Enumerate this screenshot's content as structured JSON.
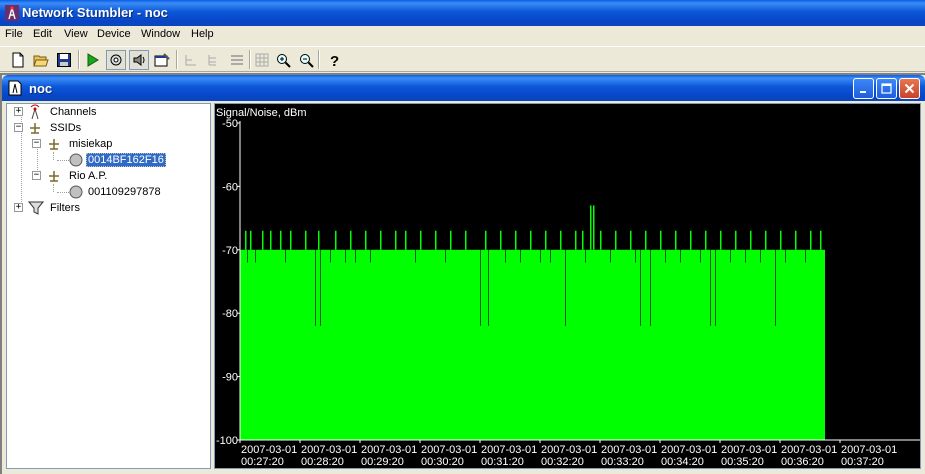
{
  "app": {
    "title": "Network Stumbler - noc",
    "menu": [
      "File",
      "Edit",
      "View",
      "Device",
      "Window",
      "Help"
    ]
  },
  "toolbar": {
    "buttons": [
      "new-document-icon",
      "open-folder-icon",
      "save-icon",
      "play-icon",
      "auto-config-icon",
      "speaker-icon",
      "properties-icon",
      "tree-collapse-icon",
      "tree-expand-icon",
      "list-view-icon",
      "grid-icon",
      "zoom-in-icon",
      "zoom-out-icon",
      "help-icon"
    ]
  },
  "child": {
    "title": "noc",
    "tree": {
      "channels": "Channels",
      "ssids": "SSIDs",
      "ssid1": "misiekap",
      "ap1": "0014BF162F16",
      "ssid2": "Rio A.P.",
      "ap2": "001109297878",
      "filters": "Filters"
    }
  },
  "colors": {
    "signal": "#00ff00",
    "background": "#000000",
    "text": "#ffffff",
    "selection": "#316ac5"
  },
  "chart_data": {
    "type": "area",
    "ylabel": "Signal/Noise, dBm",
    "ylim": [
      -100,
      -50
    ],
    "yticks": [
      "-50",
      "-60",
      "-70",
      "-80",
      "-90",
      "-100"
    ],
    "xticks": [
      {
        "date": "2007-03-01",
        "time": "00:27:20"
      },
      {
        "date": "2007-03-01",
        "time": "00:28:20"
      },
      {
        "date": "2007-03-01",
        "time": "00:29:20"
      },
      {
        "date": "2007-03-01",
        "time": "00:30:20"
      },
      {
        "date": "2007-03-01",
        "time": "00:31:20"
      },
      {
        "date": "2007-03-01",
        "time": "00:32:20"
      },
      {
        "date": "2007-03-01",
        "time": "00:33:20"
      },
      {
        "date": "2007-03-01",
        "time": "00:34:20"
      },
      {
        "date": "2007-03-01",
        "time": "00:35:20"
      },
      {
        "date": "2007-03-01",
        "time": "00:36:20"
      },
      {
        "date": "2007-03-01",
        "time": "00:37:20"
      }
    ],
    "series": [
      {
        "baseline": -70,
        "samples_start": "00:27:20",
        "samples_end": "00:37:05",
        "spikes_up": [
          {
            "t": "00:27:25",
            "v": -67
          },
          {
            "t": "00:27:30",
            "v": -67
          },
          {
            "t": "00:27:42",
            "v": -67
          },
          {
            "t": "00:27:50",
            "v": -67
          },
          {
            "t": "00:28:00",
            "v": -67
          },
          {
            "t": "00:28:10",
            "v": -67
          },
          {
            "t": "00:28:25",
            "v": -67
          },
          {
            "t": "00:28:38",
            "v": -67
          },
          {
            "t": "00:28:55",
            "v": -67
          },
          {
            "t": "00:29:10",
            "v": -67
          },
          {
            "t": "00:29:25",
            "v": -67
          },
          {
            "t": "00:29:40",
            "v": -67
          },
          {
            "t": "00:29:55",
            "v": -67
          },
          {
            "t": "00:30:05",
            "v": -67
          },
          {
            "t": "00:30:20",
            "v": -67
          },
          {
            "t": "00:30:35",
            "v": -67
          },
          {
            "t": "00:30:50",
            "v": -67
          },
          {
            "t": "00:31:05",
            "v": -67
          },
          {
            "t": "00:31:25",
            "v": -67
          },
          {
            "t": "00:31:40",
            "v": -67
          },
          {
            "t": "00:31:55",
            "v": -67
          },
          {
            "t": "00:32:10",
            "v": -67
          },
          {
            "t": "00:32:25",
            "v": -67
          },
          {
            "t": "00:32:40",
            "v": -67
          },
          {
            "t": "00:32:55",
            "v": -67
          },
          {
            "t": "00:33:02",
            "v": -67
          },
          {
            "t": "00:33:10",
            "v": -63
          },
          {
            "t": "00:33:13",
            "v": -63
          },
          {
            "t": "00:33:20",
            "v": -67
          },
          {
            "t": "00:33:35",
            "v": -67
          },
          {
            "t": "00:33:50",
            "v": -67
          },
          {
            "t": "00:34:05",
            "v": -67
          },
          {
            "t": "00:34:20",
            "v": -67
          },
          {
            "t": "00:34:35",
            "v": -67
          },
          {
            "t": "00:34:50",
            "v": -67
          },
          {
            "t": "00:35:05",
            "v": -67
          },
          {
            "t": "00:35:20",
            "v": -67
          },
          {
            "t": "00:35:35",
            "v": -67
          },
          {
            "t": "00:35:50",
            "v": -67
          },
          {
            "t": "00:36:05",
            "v": -67
          },
          {
            "t": "00:36:20",
            "v": -67
          },
          {
            "t": "00:36:35",
            "v": -67
          },
          {
            "t": "00:36:50",
            "v": -67
          },
          {
            "t": "00:37:00",
            "v": -67
          }
        ],
        "spikes_down": [
          {
            "t": "00:27:27",
            "v": -72
          },
          {
            "t": "00:27:35",
            "v": -72
          },
          {
            "t": "00:28:05",
            "v": -72
          },
          {
            "t": "00:28:35",
            "v": -82
          },
          {
            "t": "00:28:40",
            "v": -82
          },
          {
            "t": "00:28:50",
            "v": -72
          },
          {
            "t": "00:29:05",
            "v": -72
          },
          {
            "t": "00:29:15",
            "v": -72
          },
          {
            "t": "00:29:30",
            "v": -72
          },
          {
            "t": "00:30:15",
            "v": -72
          },
          {
            "t": "00:30:45",
            "v": -72
          },
          {
            "t": "00:31:20",
            "v": -82
          },
          {
            "t": "00:31:28",
            "v": -82
          },
          {
            "t": "00:31:45",
            "v": -72
          },
          {
            "t": "00:32:00",
            "v": -72
          },
          {
            "t": "00:32:20",
            "v": -72
          },
          {
            "t": "00:32:30",
            "v": -72
          },
          {
            "t": "00:32:45",
            "v": -82
          },
          {
            "t": "00:33:05",
            "v": -72
          },
          {
            "t": "00:33:30",
            "v": -72
          },
          {
            "t": "00:33:55",
            "v": -72
          },
          {
            "t": "00:34:00",
            "v": -82
          },
          {
            "t": "00:34:10",
            "v": -82
          },
          {
            "t": "00:34:25",
            "v": -72
          },
          {
            "t": "00:34:40",
            "v": -72
          },
          {
            "t": "00:35:00",
            "v": -72
          },
          {
            "t": "00:35:10",
            "v": -82
          },
          {
            "t": "00:35:15",
            "v": -82
          },
          {
            "t": "00:35:30",
            "v": -72
          },
          {
            "t": "00:35:45",
            "v": -72
          },
          {
            "t": "00:36:00",
            "v": -72
          },
          {
            "t": "00:36:15",
            "v": -82
          },
          {
            "t": "00:36:25",
            "v": -72
          },
          {
            "t": "00:36:45",
            "v": -72
          }
        ]
      }
    ],
    "grid": false
  }
}
